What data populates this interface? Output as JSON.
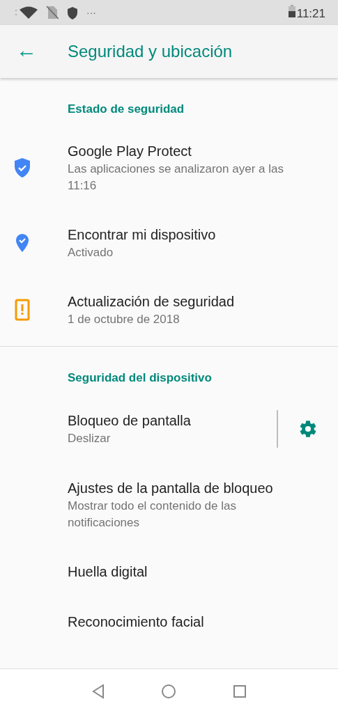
{
  "status_bar": {
    "overflow": "···",
    "time": "11:21"
  },
  "app_bar": {
    "back": "←",
    "title": "Seguridad y ubicación"
  },
  "sections": [
    {
      "header": "Estado de seguridad",
      "items": [
        {
          "kind": "shield",
          "title": "Google Play Protect",
          "subtitle": "Las aplicaciones se analizaron ayer a las 11:16"
        },
        {
          "kind": "pin",
          "title": "Encontrar mi dispositivo",
          "subtitle": "Activado"
        },
        {
          "kind": "alert",
          "title": "Actualización de seguridad",
          "subtitle": "1 de octubre de 2018"
        }
      ]
    },
    {
      "header": "Seguridad del dispositivo",
      "items": [
        {
          "title": "Bloqueo de pantalla",
          "subtitle": "Deslizar",
          "settings": true
        },
        {
          "title": "Ajustes de la pantalla de bloqueo",
          "subtitle": "Mostrar todo el contenido de las notificaciones"
        },
        {
          "title": "Huella digital"
        },
        {
          "title": "Reconocimiento facial"
        }
      ]
    }
  ]
}
